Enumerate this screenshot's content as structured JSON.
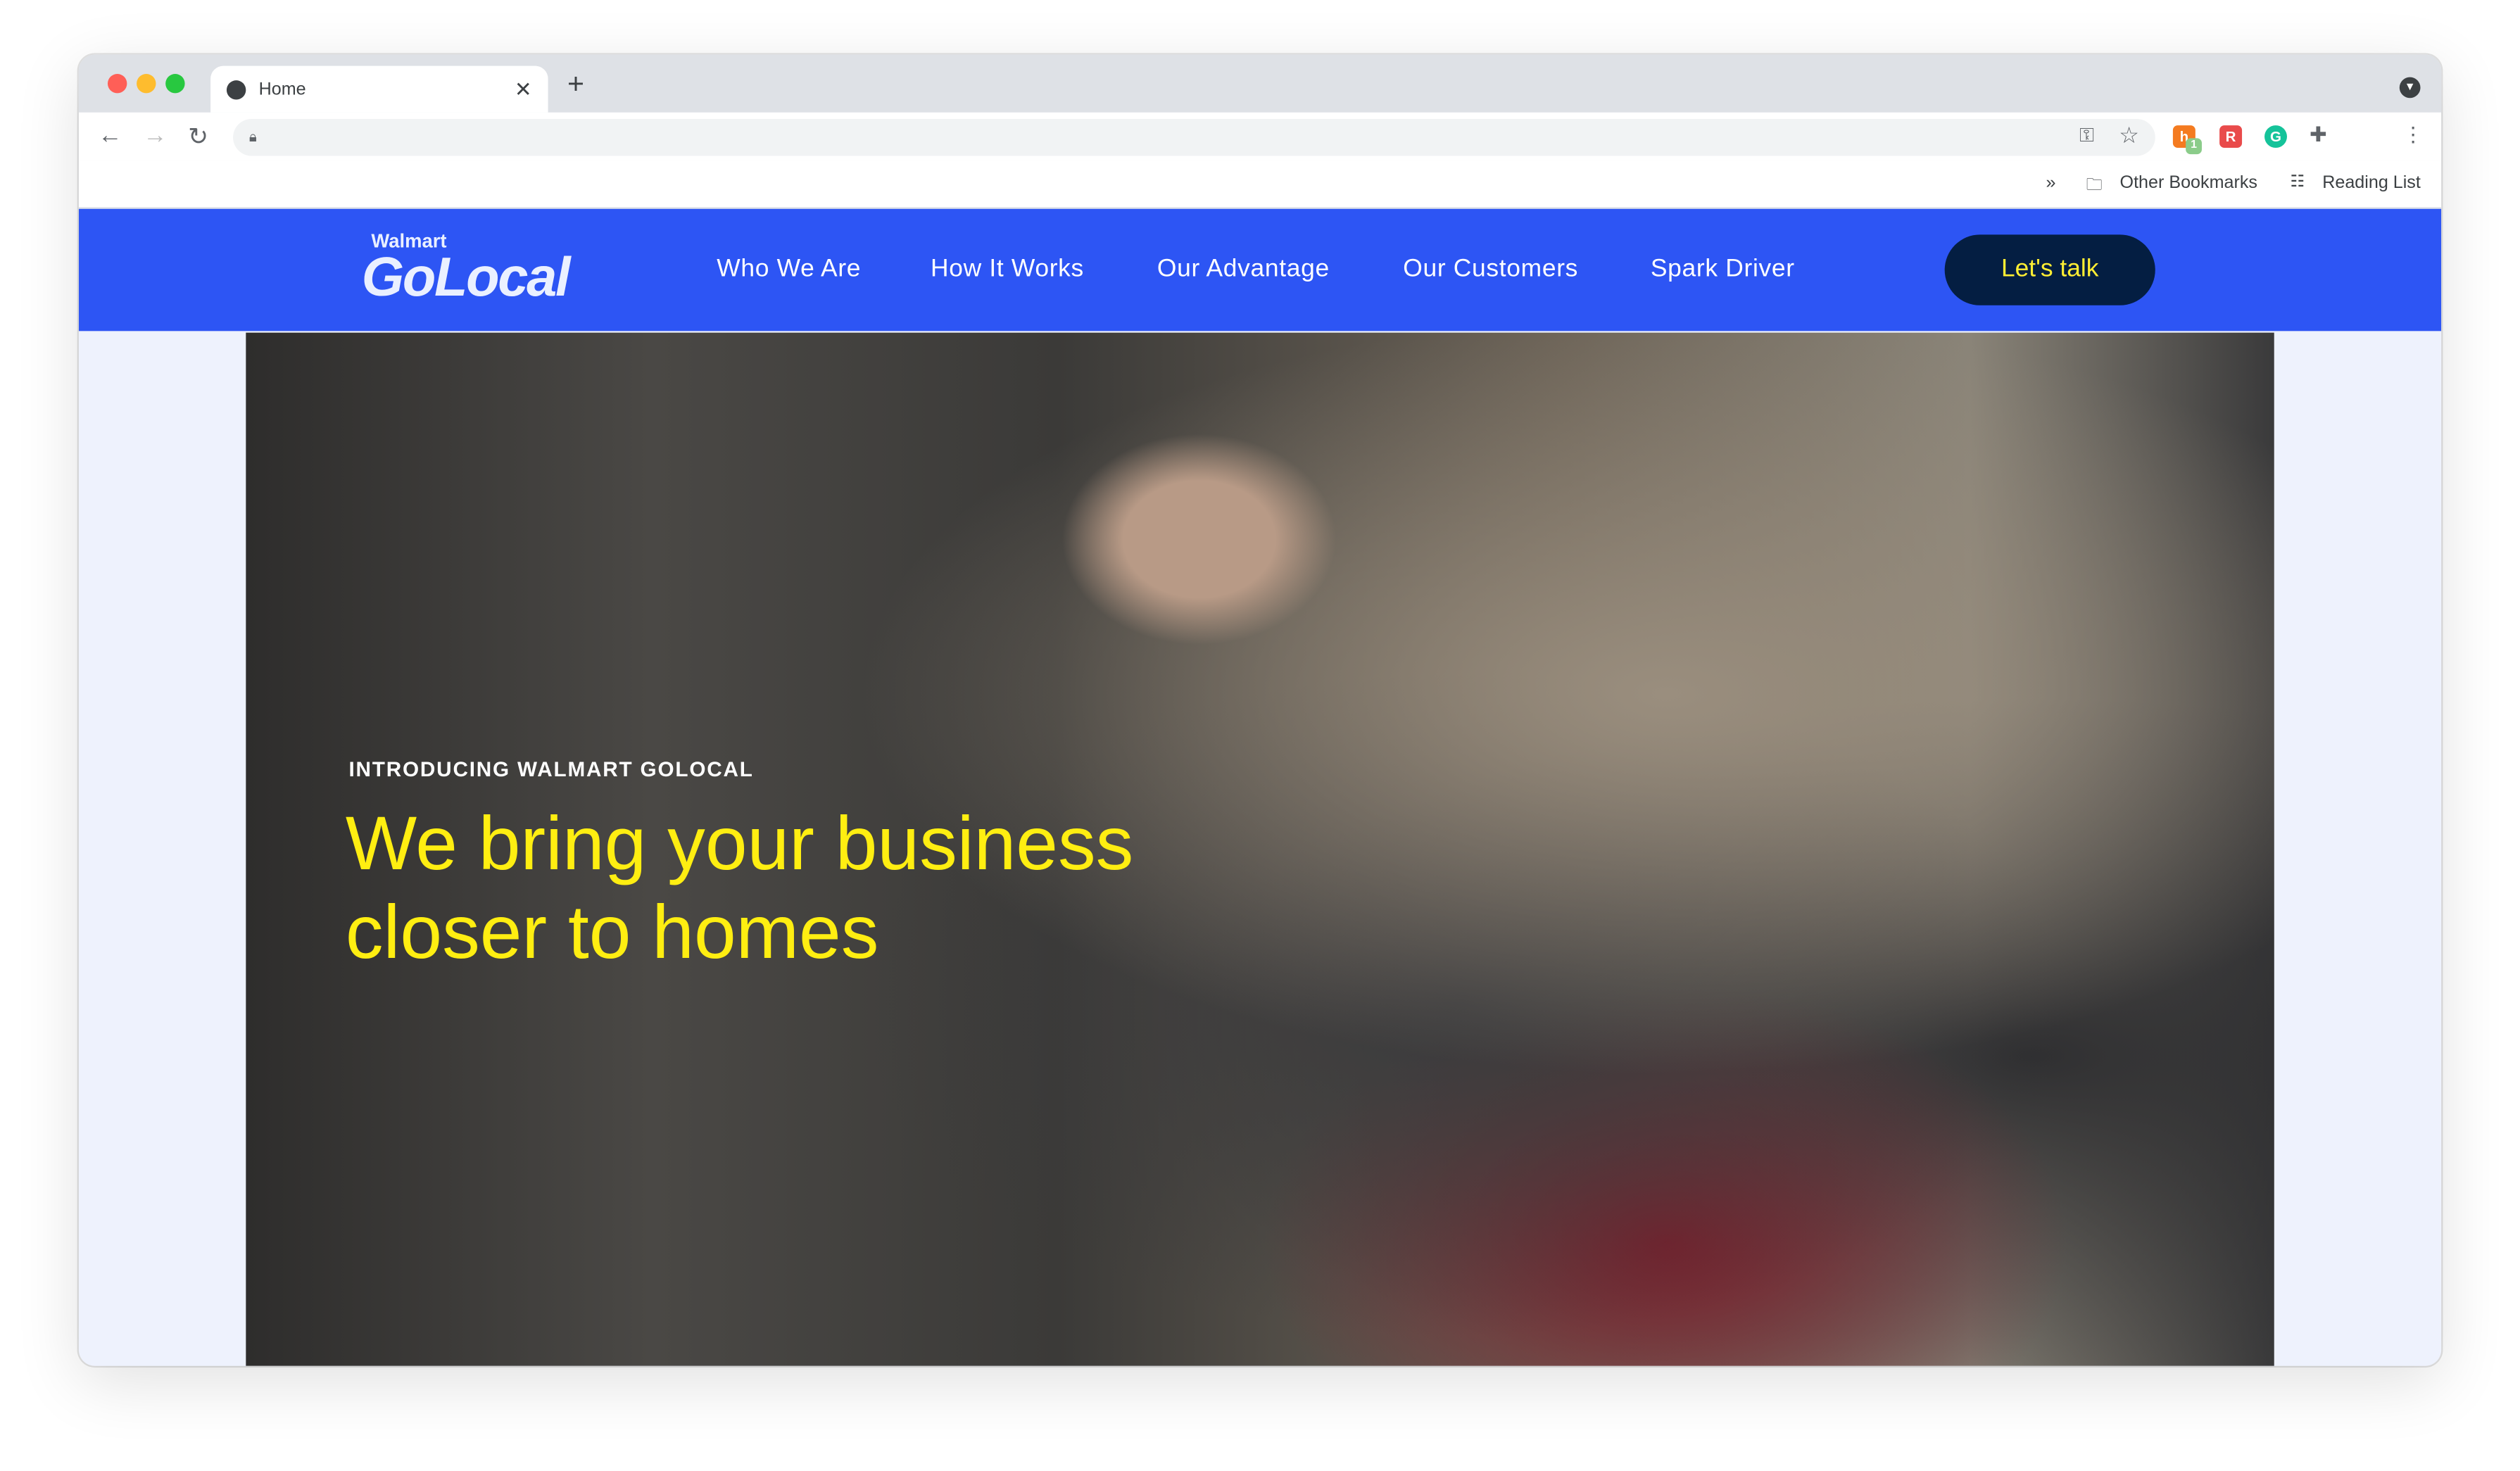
{
  "browser": {
    "tab_title": "Home",
    "bookmarks": {
      "overflow": "»",
      "other": "Other Bookmarks",
      "reading_list": "Reading List"
    },
    "extension_badge": "1"
  },
  "site": {
    "logo_top": "Walmart",
    "logo_main": "GoLocal",
    "nav": [
      "Who We Are",
      "How It Works",
      "Our Advantage",
      "Our Customers",
      "Spark Driver"
    ],
    "cta": "Let's talk",
    "hero": {
      "eyebrow": "INTRODUCING WALMART GOLOCAL",
      "headline": "We bring your business closer to homes"
    }
  },
  "colors": {
    "nav_bg": "#2d55f4",
    "cta_bg": "#041e42",
    "accent_yellow": "#ffee11"
  }
}
